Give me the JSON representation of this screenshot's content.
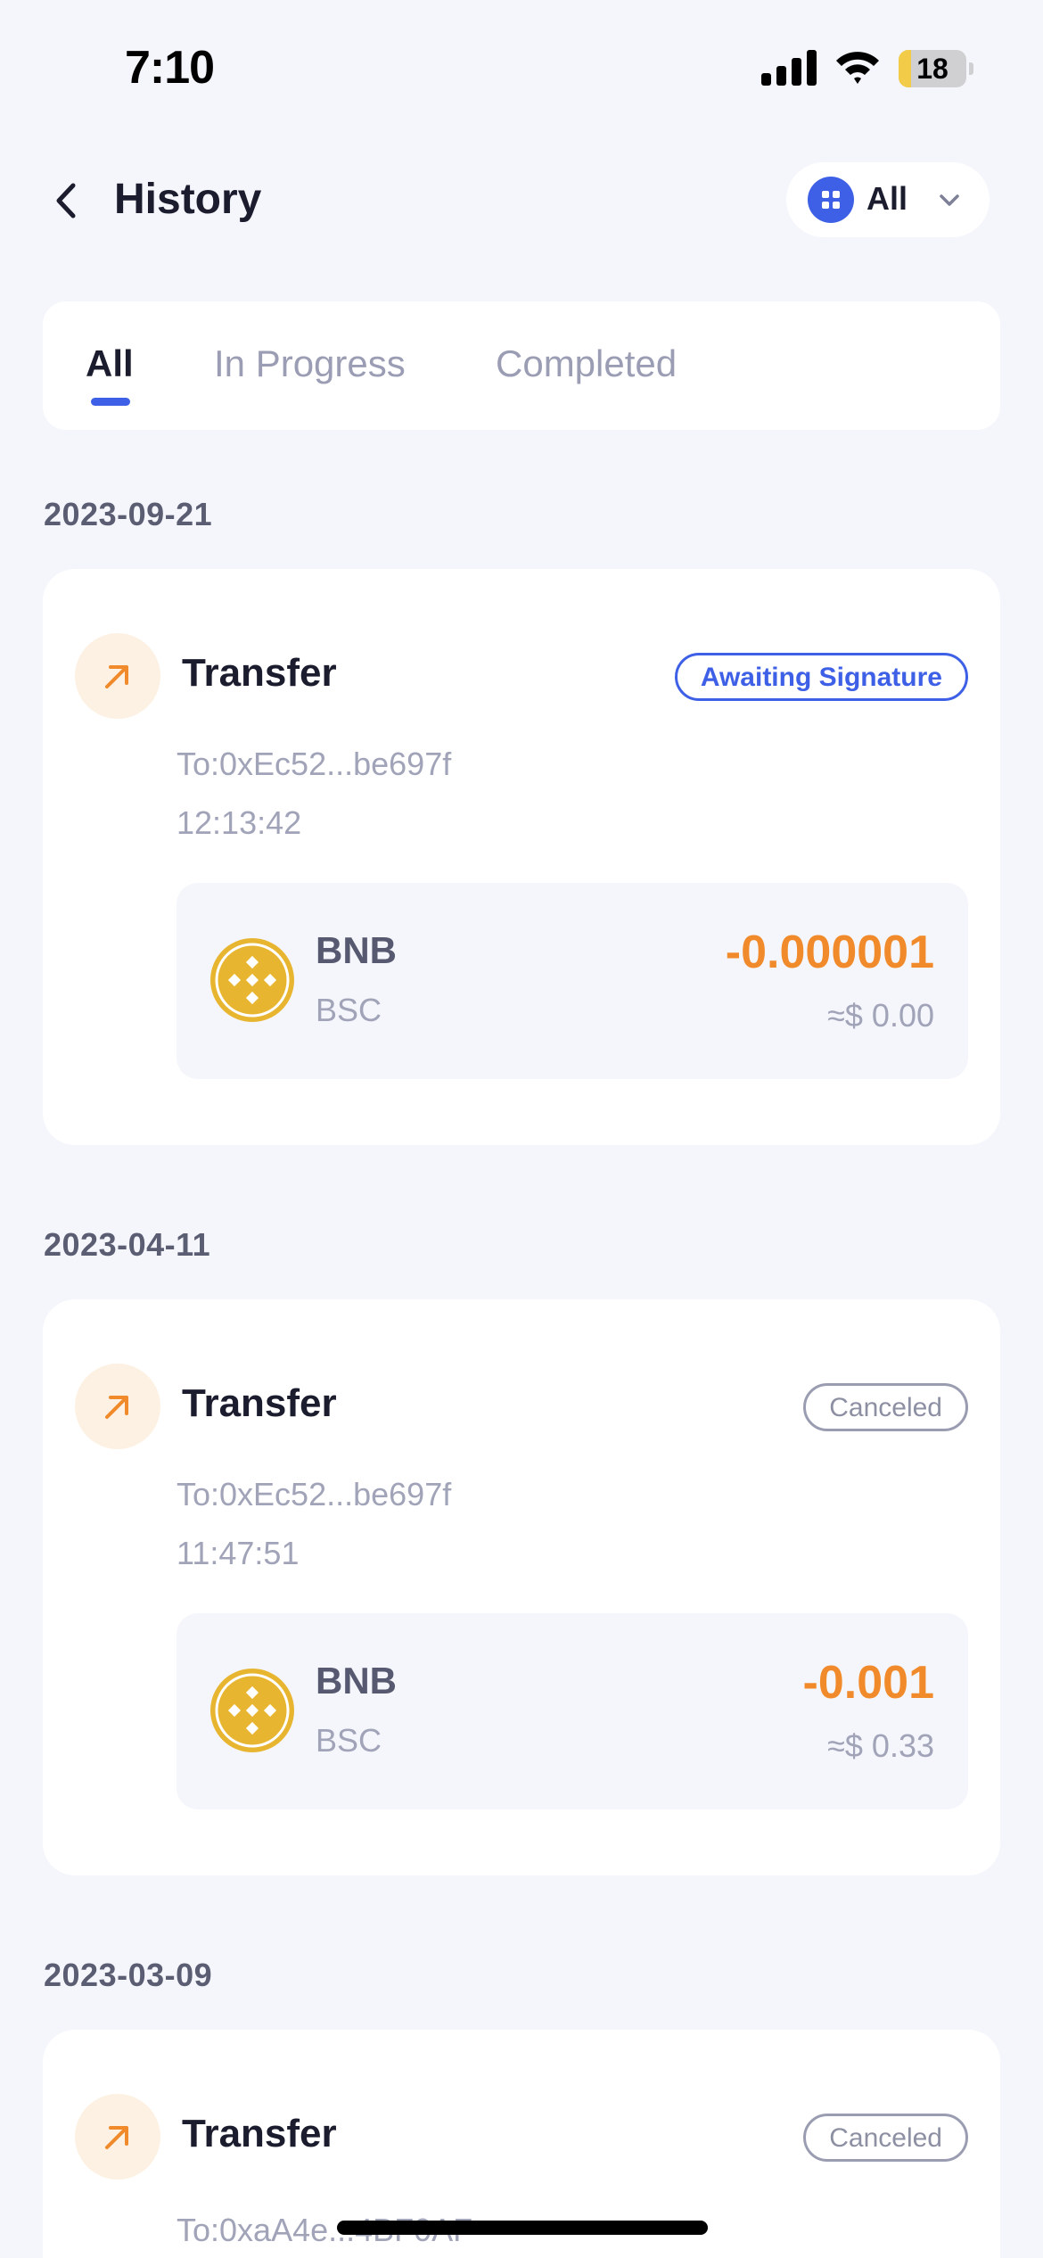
{
  "status_bar": {
    "time": "7:10",
    "battery": "18",
    "battery_level": 0.18
  },
  "header": {
    "title": "History",
    "filter_label": "All"
  },
  "tabs": [
    {
      "label": "All",
      "active": true
    },
    {
      "label": "In Progress",
      "active": false
    },
    {
      "label": "Completed",
      "active": false
    }
  ],
  "groups": [
    {
      "date": "2023-09-21",
      "tx": {
        "type": "Transfer",
        "status": "Awaiting Signature",
        "to": "To:0xEc52...be697f",
        "time": "12:13:42",
        "asset": {
          "symbol": "BNB",
          "chain": "BSC",
          "amount": "-0.000001",
          "fiat": "≈$ 0.00"
        }
      }
    },
    {
      "date": "2023-04-11",
      "tx": {
        "type": "Transfer",
        "status": "Canceled",
        "to": "To:0xEc52...be697f",
        "time": "11:47:51",
        "asset": {
          "symbol": "BNB",
          "chain": "BSC",
          "amount": "-0.001",
          "fiat": "≈$ 0.33"
        }
      }
    },
    {
      "date": "2023-03-09",
      "tx": {
        "type": "Transfer",
        "status": "Canceled",
        "to": "To:0xaA4e...4BF0AF"
      }
    }
  ],
  "colors": {
    "accent": "#3e60e6",
    "amount": "#f08a2a",
    "coin": "#e8b531",
    "background": "#f5f6fb"
  },
  "icons": [
    "back-arrow",
    "grid-icon",
    "chevron-down",
    "arrow-up-right",
    "bnb-coin"
  ]
}
